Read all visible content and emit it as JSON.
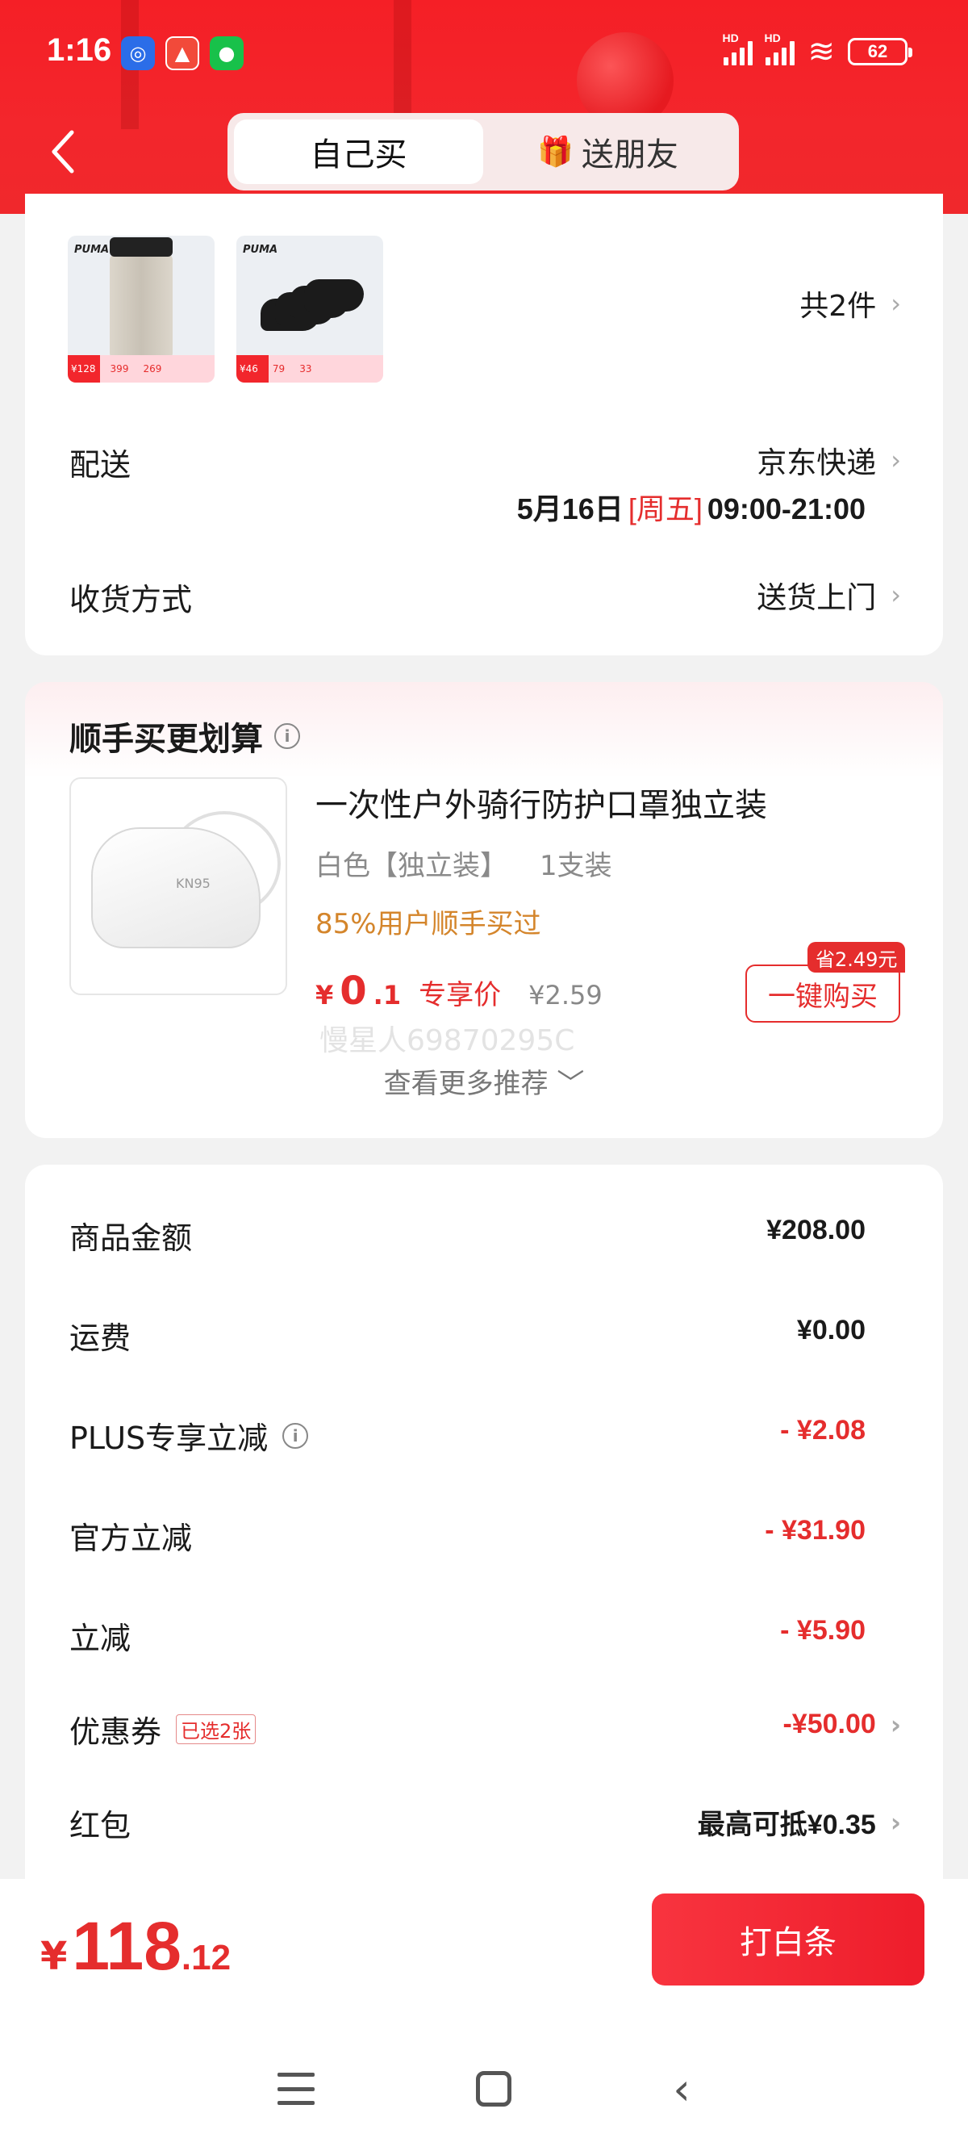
{
  "status_bar": {
    "time": "1:16",
    "battery": "62",
    "signal_label": "HD"
  },
  "header": {
    "tabs": [
      {
        "label": "自己买",
        "active": true
      },
      {
        "label": "送朋友",
        "active": false,
        "icon": "gift-icon"
      }
    ],
    "accent": "#f3262c"
  },
  "order": {
    "thumbs": [
      {
        "brand": "PUMA",
        "prices": [
          "¥128",
          "399",
          "269"
        ]
      },
      {
        "brand": "PUMA",
        "prices": [
          "¥46",
          "79",
          "33"
        ]
      }
    ],
    "count_label": "共2件",
    "delivery": {
      "label": "配送",
      "carrier": "京东快递",
      "date": "5月16日",
      "weekday": "[周五]",
      "time_window": "09:00-21:00"
    },
    "receive": {
      "label": "收货方式",
      "value": "送货上门"
    }
  },
  "addon": {
    "title": "顺手买更划算",
    "product_name": "一次性户外骑行防护口罩独立装",
    "spec_color": "白色【独立装】",
    "spec_qty": "1支装",
    "bought_text": "85%用户顺手买过",
    "price_currency": "¥",
    "price_int": "0",
    "price_dec": ".1",
    "price_tag": "专享价",
    "orig_price": "¥2.59",
    "watermark": "慢星人69870295C",
    "save_badge": "省2.49元",
    "buy_label": "一键购买",
    "see_more": "查看更多推荐 ﹀",
    "mask_label": "KN95"
  },
  "fees": [
    {
      "label": "商品金额",
      "value": "¥208.00",
      "red": false
    },
    {
      "label": "运费",
      "value": "¥0.00",
      "red": false
    },
    {
      "label": "PLUS专享立减",
      "value": "- ¥2.08",
      "red": true,
      "info": true
    },
    {
      "label": "官方立减",
      "value": "- ¥31.90",
      "red": true
    },
    {
      "label": "立减",
      "value": "- ¥5.90",
      "red": true
    }
  ],
  "coupon": {
    "label": "优惠券",
    "tag": "已选2张",
    "value": "-¥50.00"
  },
  "redpacket": {
    "label": "红包",
    "value": "最高可抵¥0.35"
  },
  "footer": {
    "total_currency": "¥",
    "total_int": "118",
    "total_dec": ".12",
    "pay_label": "打白条"
  }
}
